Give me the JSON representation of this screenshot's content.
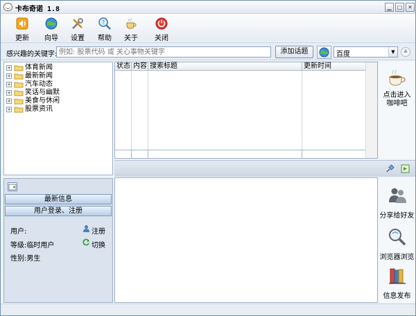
{
  "window": {
    "title": "卡布奇诺 1.8",
    "controls": [
      "minimize",
      "maximize",
      "close"
    ]
  },
  "toolbar": {
    "buttons": [
      {
        "label": "更新",
        "icon": "update-speaker-icon"
      },
      {
        "label": "向导",
        "icon": "wizard-globe-icon"
      },
      {
        "label": "设置",
        "icon": "settings-tools-icon"
      },
      {
        "label": "帮助",
        "icon": "help-magnifier-icon"
      },
      {
        "label": "关于",
        "icon": "about-coffee-icon"
      },
      {
        "label": "关闭",
        "icon": "power-close-icon"
      }
    ]
  },
  "search": {
    "label": "感兴趣的关键字:",
    "placeholder": "例如: 股票代码 或 关心事物关键字",
    "add_button": "添加话题",
    "engine": "百度"
  },
  "tree": {
    "items": [
      {
        "label": "体育新闻"
      },
      {
        "label": "最新新闻"
      },
      {
        "label": "汽车动态"
      },
      {
        "label": "笑话与幽默"
      },
      {
        "label": "美食与休闲"
      },
      {
        "label": "股票资讯"
      }
    ]
  },
  "results_table": {
    "columns": [
      "状态",
      "内容",
      "搜索标题",
      "更新时间"
    ]
  },
  "coffee_panel": {
    "label_line1": "点击进入",
    "label_line2": "咖啡吧"
  },
  "user_panel": {
    "latest_button": "最新信息",
    "login_button": "用户登录、注册",
    "user_label": "用户:",
    "register_link": "注册",
    "level_label": "等级:临时用户",
    "switch_link": "切换",
    "gender_label": "性别:男生"
  },
  "side_tools": [
    {
      "label": "分享给好友",
      "icon": "share-friends-icon"
    },
    {
      "label": "浏览器浏览",
      "icon": "browser-view-icon"
    },
    {
      "label": "信息发布",
      "icon": "publish-books-icon"
    }
  ],
  "colors": {
    "accent": "#7c98bd",
    "panel": "#d8e1ec",
    "link": "#1e57b7"
  }
}
